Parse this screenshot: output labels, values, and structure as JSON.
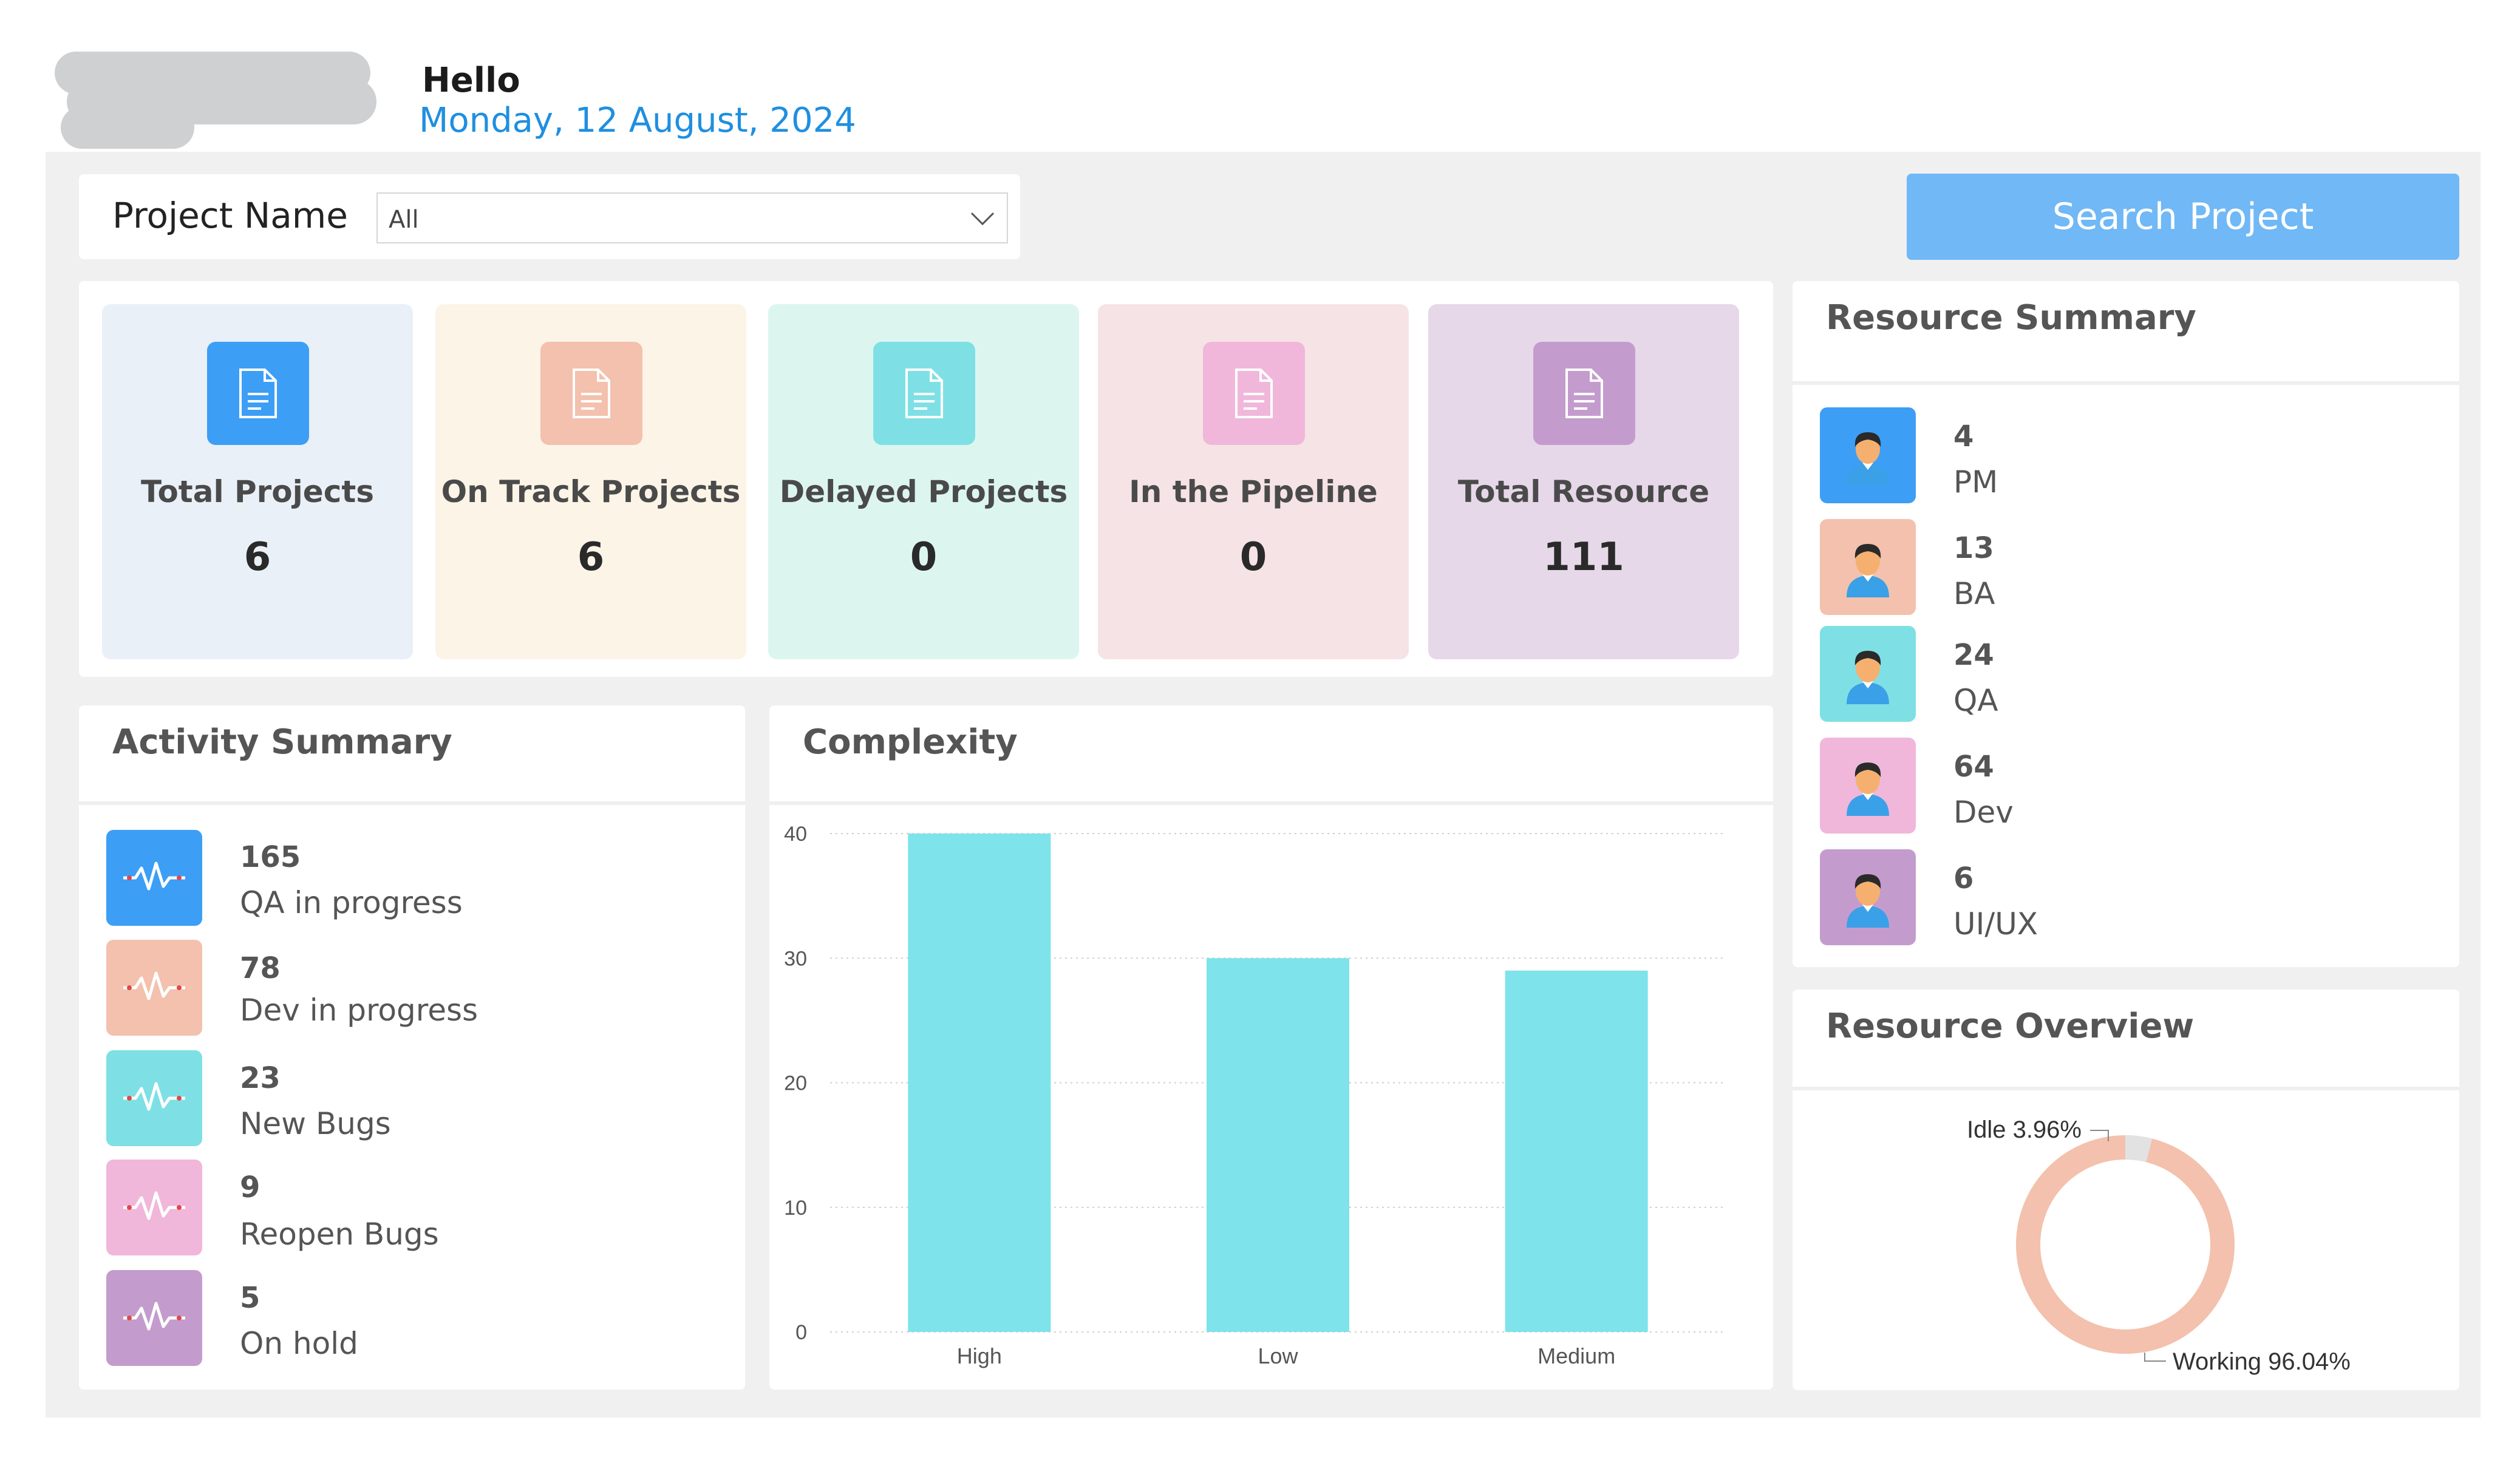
{
  "header": {
    "greeting": "Hello",
    "date": "Monday, 12 August, 2024"
  },
  "filter": {
    "label": "Project Name",
    "selected": "All"
  },
  "search_button": "Search Project",
  "stats": [
    {
      "label": "Total Projects",
      "value": "6",
      "bg": "#e9f0f8",
      "icon_bg": "#3d9ef5"
    },
    {
      "label": "On Track Projects",
      "value": "6",
      "bg": "#fbf4e7",
      "icon_bg": "#f3c1ad"
    },
    {
      "label": "Delayed Projects",
      "value": "0",
      "bg": "#dcf6ef",
      "icon_bg": "#7ee0e5"
    },
    {
      "label": "In the Pipeline",
      "value": "0",
      "bg": "#f6e3e5",
      "icon_bg": "#f0b7da"
    },
    {
      "label": "Total Resource",
      "value": "111",
      "bg": "#e6d8e9",
      "icon_bg": "#c39ccd"
    }
  ],
  "activity": {
    "title": "Activity Summary",
    "items": [
      {
        "value": "165",
        "label": "QA in progress",
        "color": "#3d9ef5"
      },
      {
        "value": "78",
        "label": "Dev in progress",
        "color": "#f3c1ad"
      },
      {
        "value": "23",
        "label": "New Bugs",
        "color": "#7ee0e5"
      },
      {
        "value": "9",
        "label": "Reopen Bugs",
        "color": "#f0b7da"
      },
      {
        "value": "5",
        "label": "On hold",
        "color": "#c39ccd"
      }
    ]
  },
  "complexity": {
    "title": "Complexity"
  },
  "chart_data": {
    "type": "bar",
    "categories": [
      "High",
      "Low",
      "Medium"
    ],
    "values": [
      40,
      30,
      29
    ],
    "ylim": [
      0,
      40
    ],
    "yticks": [
      "0",
      "10",
      "20",
      "30",
      "40"
    ],
    "color": "#7ee3ea",
    "grid": true
  },
  "resource_summary": {
    "title": "Resource Summary",
    "items": [
      {
        "value": "4",
        "label": "PM",
        "color": "#3d9ef5"
      },
      {
        "value": "13",
        "label": "BA",
        "color": "#f3c1ad"
      },
      {
        "value": "24",
        "label": "QA",
        "color": "#7ee0e5"
      },
      {
        "value": "64",
        "label": "Dev",
        "color": "#f0b7da"
      },
      {
        "value": "6",
        "label": "UI/UX",
        "color": "#c39ccd"
      }
    ]
  },
  "resource_overview": {
    "title": "Resource Overview",
    "idle_label": "Idle 3.96%",
    "working_label": "Working 96.04%",
    "idle_pct": 3.96,
    "working_pct": 96.04,
    "idle_color": "#e2e2e2",
    "working_color": "#f3c1ad"
  }
}
